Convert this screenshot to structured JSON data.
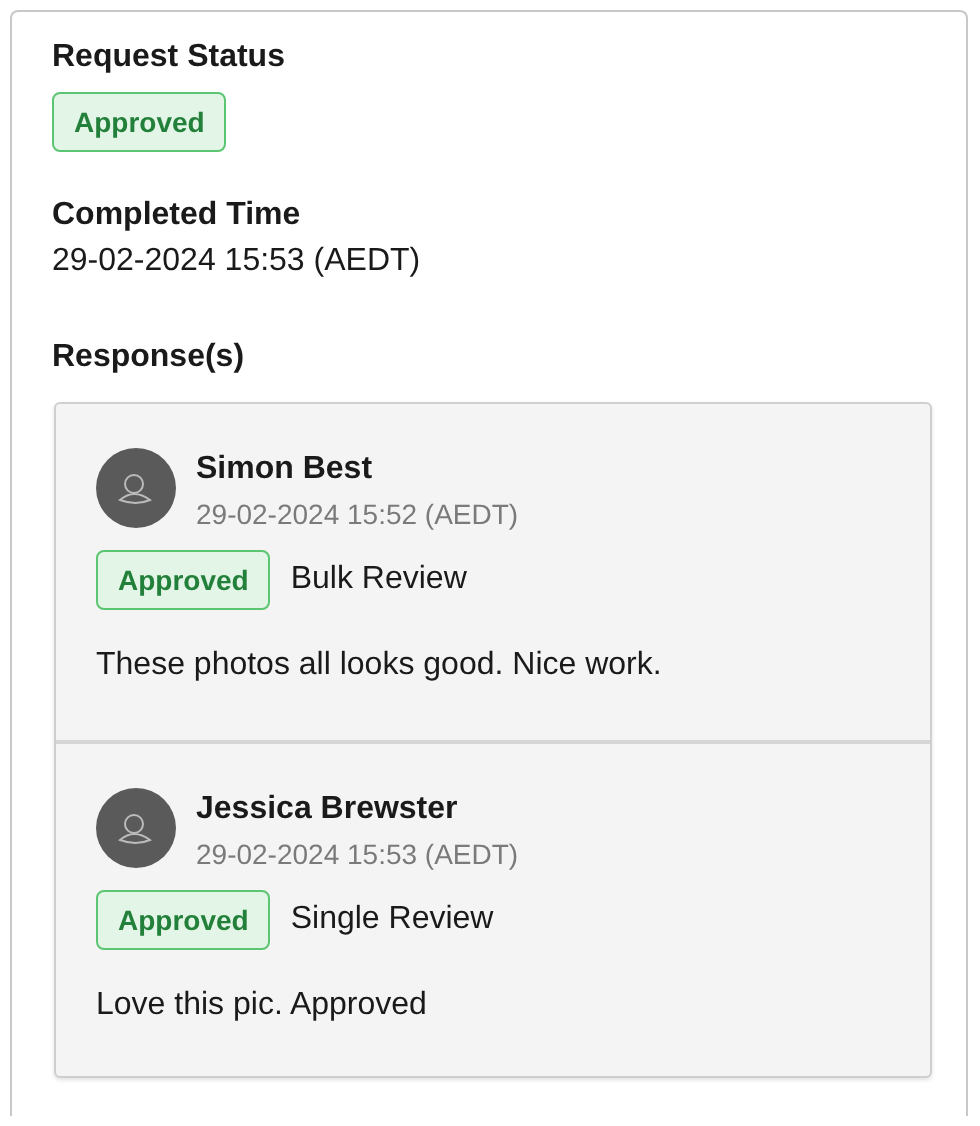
{
  "request_status": {
    "label": "Request Status",
    "badge": {
      "text": "Approved",
      "kind": "approved"
    }
  },
  "completed_time": {
    "label": "Completed Time",
    "value": "29-02-2024 15:53 (AEDT)"
  },
  "responses": {
    "label": "Response(s)",
    "items": [
      {
        "name": "Simon Best",
        "time": "29-02-2024 15:52 (AEDT)",
        "badge": {
          "text": "Approved",
          "kind": "approved"
        },
        "review_type": "Bulk Review",
        "comment": "These photos all looks good. Nice work."
      },
      {
        "name": "Jessica Brewster",
        "time": "29-02-2024 15:53 (AEDT)",
        "badge": {
          "text": "Approved",
          "kind": "approved"
        },
        "review_type": "Single Review",
        "comment": "Love this pic. Approved"
      }
    ]
  }
}
